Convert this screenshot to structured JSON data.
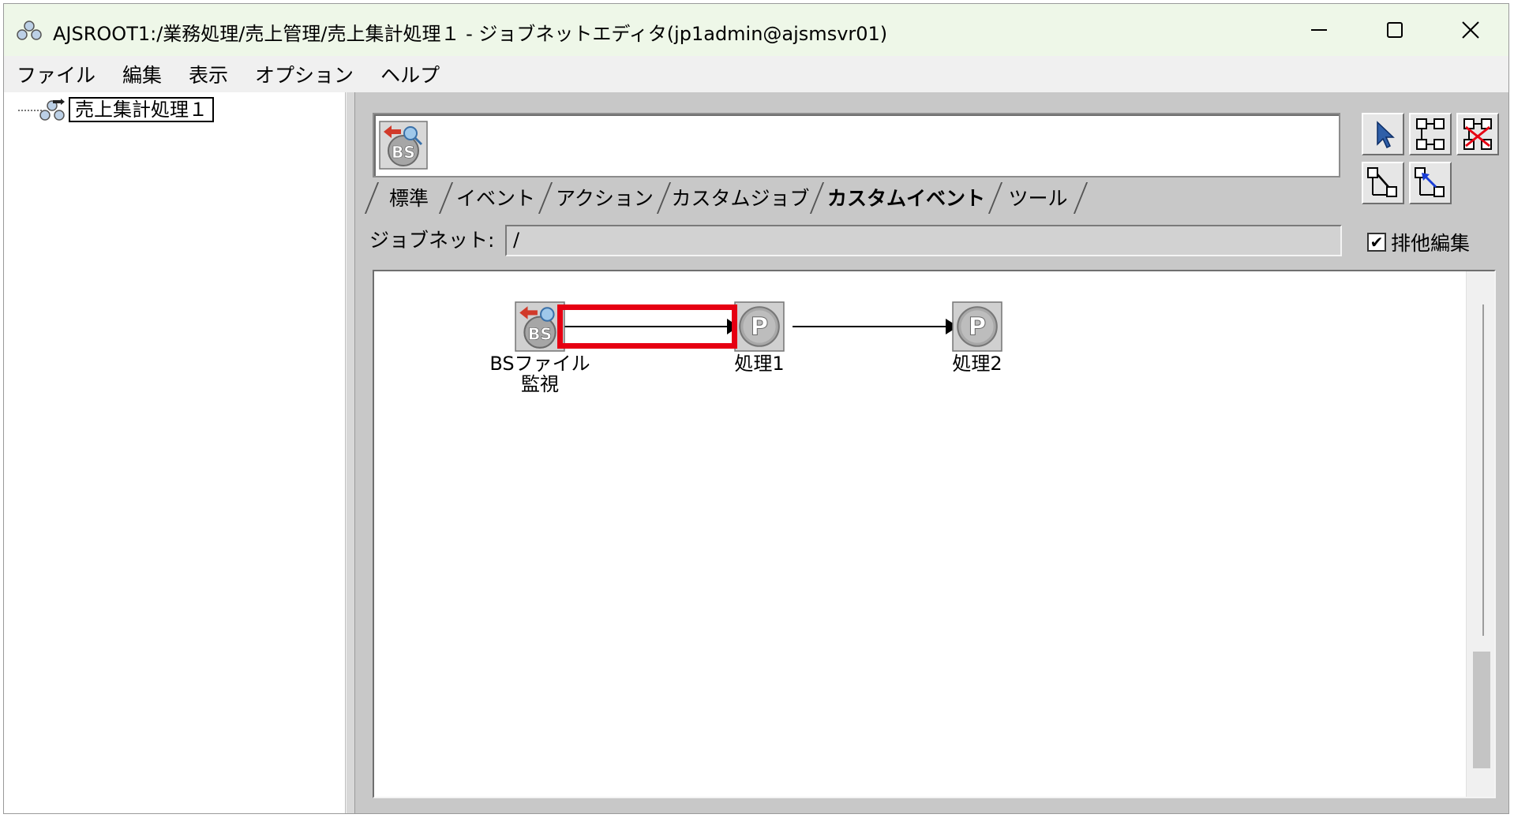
{
  "window": {
    "title": "AJSROOT1:/業務処理/売上管理/売上集計処理１ - ジョブネットエディタ(jp1admin@ajsmsvr01)",
    "controls": {
      "minimize_icon": "minimize-icon",
      "maximize_icon": "maximize-icon",
      "close_icon": "close-icon"
    }
  },
  "menubar": {
    "items": [
      {
        "label": "ファイル"
      },
      {
        "label": "編集"
      },
      {
        "label": "表示"
      },
      {
        "label": "オプション"
      },
      {
        "label": "ヘルプ"
      }
    ]
  },
  "tree": {
    "root_label": "売上集計処理１",
    "root_icon": "jobnet-icon"
  },
  "palette": {
    "selected_icon": "bs-file-monitor-icon",
    "selected_icon_text": "BS",
    "tabs": [
      {
        "label": "標準",
        "active": false
      },
      {
        "label": "イベント",
        "active": false
      },
      {
        "label": "アクション",
        "active": false
      },
      {
        "label": "カスタムジョブ",
        "active": false
      },
      {
        "label": "カスタムイベント",
        "active": true
      },
      {
        "label": "ツール",
        "active": false
      }
    ]
  },
  "tools": [
    {
      "name": "select-tool-icon"
    },
    {
      "name": "connect-tool-icon"
    },
    {
      "name": "disconnect-tool-icon"
    },
    {
      "name": "relation-line-tool-icon"
    },
    {
      "name": "relation-reverse-tool-icon"
    }
  ],
  "jobnet": {
    "label": "ジョブネット:",
    "value": "/"
  },
  "exclusive_edit": {
    "label": "排他編集",
    "checked": true,
    "check_mark": "✔"
  },
  "canvas": {
    "nodes": [
      {
        "id": "bs",
        "icon": "bs-file-monitor-icon",
        "icon_text": "BS",
        "label_line1": "BSファイル",
        "label_line2": "監視"
      },
      {
        "id": "p1",
        "icon": "pc-job-icon",
        "icon_text": "P",
        "label_line1": "処理1"
      },
      {
        "id": "p2",
        "icon": "pc-job-icon",
        "icon_text": "P",
        "label_line1": "処理2"
      }
    ],
    "highlight_color": "#e60012"
  }
}
